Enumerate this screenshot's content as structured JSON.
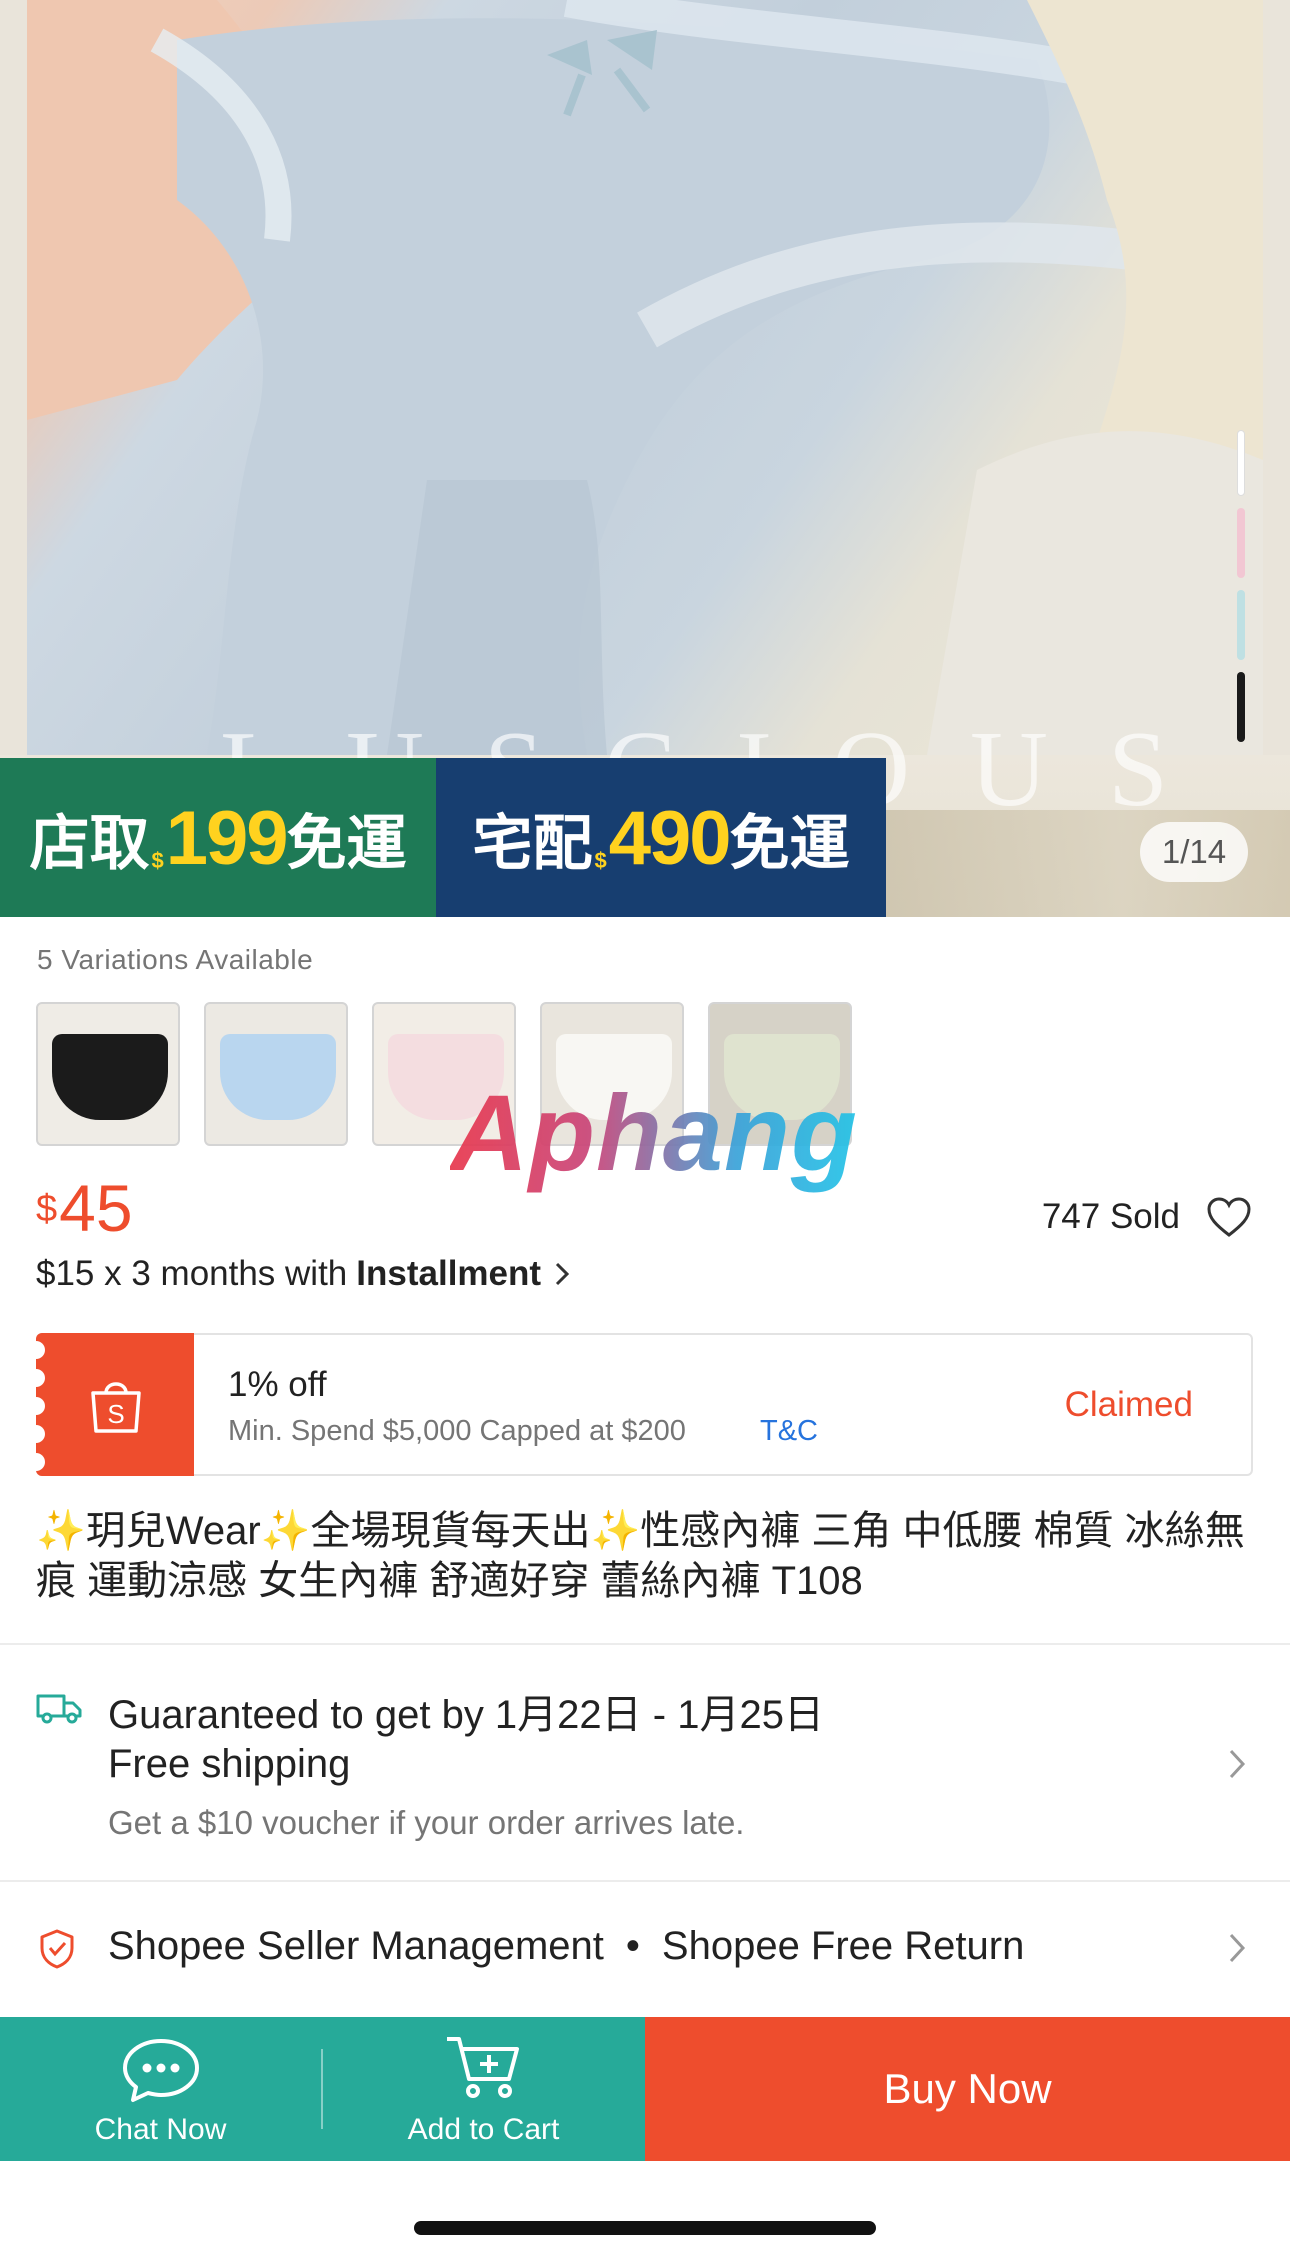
{
  "hero": {
    "brand_letters": "LUSCIOUS",
    "counter": "1/14",
    "promo_store": {
      "prefix": "店取",
      "currency": "$",
      "amount": "199",
      "suffix": "免運"
    },
    "promo_home": {
      "prefix": "宅配",
      "currency": "$",
      "amount": "490",
      "suffix": "免運"
    },
    "swatch_colors": [
      "#ffffff",
      "#f2c7d3",
      "#bfe0e3",
      "#1a1a1a"
    ]
  },
  "variations": {
    "label": "5 Variations Available",
    "thumb_colors": [
      "#1b1b1b",
      "#b9d6ef",
      "#f4dde0",
      "#f1efe9",
      "#dfe3cf"
    ]
  },
  "watermark": "Aphang",
  "price": {
    "currency": "$",
    "amount": "45"
  },
  "sold": "747 Sold",
  "installment": {
    "prefix": "$15 x 3 months with",
    "label": "Installment"
  },
  "voucher": {
    "title": "1% off",
    "subtitle": "Min. Spend $5,000 Capped at $200",
    "tc": "T&C",
    "status": "Claimed"
  },
  "product_title": "✨玥兒Wear✨全場現貨每天出✨性感內褲 三角 中低腰 棉質 冰絲無痕 運動涼感 女生內褲 舒適好穿 蕾絲內褲 T108",
  "shipping": {
    "line1": "Guaranteed to get by 1月22日 - 1月25日",
    "line2": "Free shipping",
    "line3": "Get a $10 voucher if your order arrives late."
  },
  "guarantee": {
    "item1": "Shopee Seller Management",
    "separator": "•",
    "item2": "Shopee Free Return"
  },
  "bottom_bar": {
    "chat": "Chat Now",
    "cart": "Add to Cart",
    "buy": "Buy Now"
  },
  "colors": {
    "accent": "#ee4d2d",
    "teal": "#26aa99",
    "link": "#2673dd"
  }
}
